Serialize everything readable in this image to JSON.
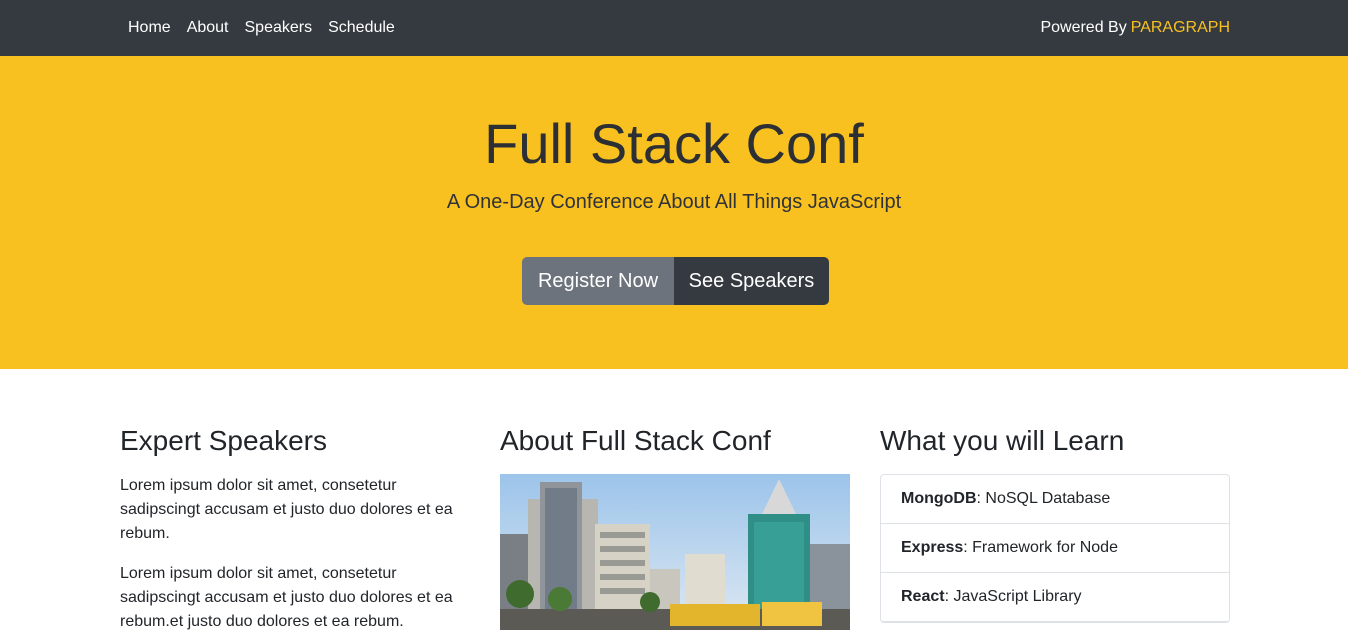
{
  "nav": {
    "links": [
      "Home",
      "About",
      "Speakers",
      "Schedule"
    ],
    "powered_by_label": "Powered By",
    "powered_by_brand": "PARAGRAPH"
  },
  "hero": {
    "title": "Full Stack Conf",
    "subtitle": "A One-Day Conference About All Things JavaScript",
    "register_label": "Register Now",
    "speakers_label": "See Speakers"
  },
  "speakers_section": {
    "heading": "Expert Speakers",
    "paragraphs": [
      "Lorem ipsum dolor sit amet, consetetur sadipscingt accusam et justo duo dolores et ea rebum.",
      "Lorem ipsum dolor sit amet, consetetur sadipscingt accusam et justo duo dolores et ea rebum.et justo duo dolores et ea rebum."
    ]
  },
  "about_section": {
    "heading": "About Full Stack Conf"
  },
  "learn_section": {
    "heading": "What you will Learn",
    "items": [
      {
        "name": "MongoDB",
        "desc": ": NoSQL Database"
      },
      {
        "name": "Express",
        "desc": ": Framework for Node"
      },
      {
        "name": "React",
        "desc": ": JavaScript Library"
      }
    ]
  },
  "colors": {
    "navbar": "#343a40",
    "brand": "#f9c11f",
    "hero": "#f9c11f",
    "button_secondary": "#6c737c",
    "button_dark": "#343a40"
  }
}
